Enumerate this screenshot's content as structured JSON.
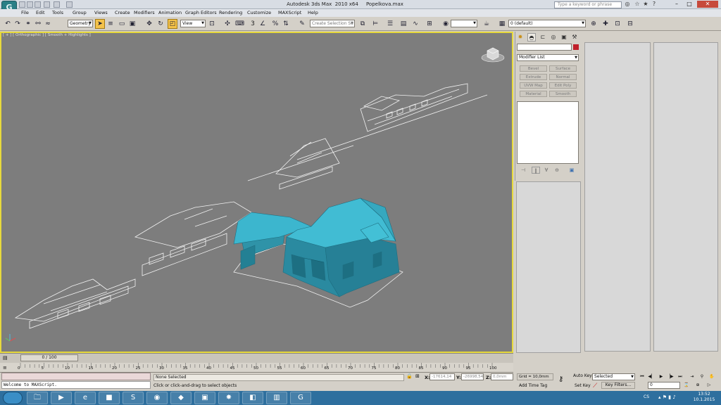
{
  "app": {
    "title": "Autodesk 3ds Max  2010 x64",
    "file": "Popelkova.max",
    "logo_letter": "G"
  },
  "search": {
    "placeholder": "Type a keyword or phrase"
  },
  "menu": [
    "File",
    "Edit",
    "Tools",
    "Group",
    "Views",
    "Create",
    "Modifiers",
    "Animation",
    "Graph Editors",
    "Rendering",
    "Customize",
    "MAXScript",
    "Help"
  ],
  "toolbar": {
    "selection_filter": "Geometry",
    "ref_coord": "View",
    "named_selection": "Create Selection Se",
    "layer": "0 (default)",
    "snap_labels": [
      "3",
      "%"
    ]
  },
  "viewport": {
    "label": "[ + ] [ Orthographic ] [ Smooth + Highlights ]",
    "model_color": "#3aa9bf"
  },
  "command_panel": {
    "modifier_list": "Modifier List",
    "buttons": [
      "Bevel",
      "Surface",
      "Extrude",
      "Normal",
      "UVW Map",
      "Edit Poly",
      "Material",
      "Smooth"
    ]
  },
  "time": {
    "slider": "0 / 100",
    "ticks": [
      "0",
      "5",
      "10",
      "15",
      "20",
      "25",
      "30",
      "35",
      "40",
      "45",
      "50",
      "55",
      "60",
      "65",
      "70",
      "75",
      "80",
      "85",
      "90",
      "95",
      "100"
    ]
  },
  "status": {
    "script_output": "",
    "script_input": "Welcome to MAXScript.",
    "selection": "None Selected",
    "prompt": "Click or click-and-drag to select objects",
    "x_label": "X:",
    "x": "-17614,14",
    "y_label": "Y:",
    "y": "-26998,54",
    "z_label": "Z:",
    "z": "0,0mm",
    "grid": "Grid = 10,0mm",
    "add_time_tag": "Add Time Tag",
    "auto_key": "Auto Key",
    "set_key": "Set Key",
    "key_mode": "Selected",
    "key_filters": "Key Filters...",
    "frame": "0"
  },
  "taskbar": {
    "lang": "CS",
    "time": "13:52",
    "date": "10.1.2015"
  }
}
